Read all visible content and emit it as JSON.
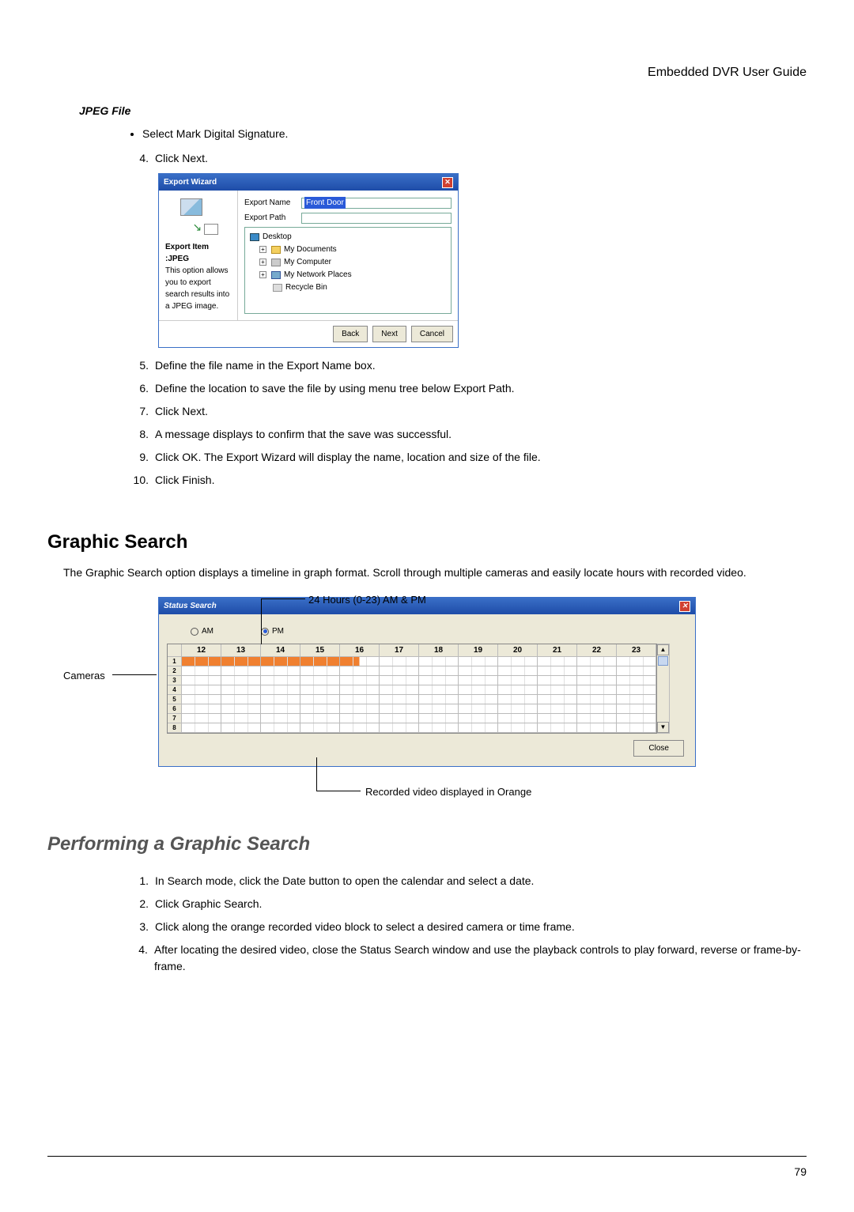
{
  "header": {
    "title": "Embedded DVR User Guide"
  },
  "page_number": "79",
  "jpeg_file": {
    "heading": "JPEG File",
    "bullet1": "Select Mark Digital Signature.",
    "step4_num": "4.",
    "step4": "Click Next.",
    "step5_num": "5.",
    "step5_a": "Define the file name in the ",
    "step5_b": "Export Name ",
    "step5_c": "box.",
    "step6_num": "6.",
    "step6_a": "Define the location to save the file by using menu tree below ",
    "step6_b": "Export Path.",
    "step7_num": "7.",
    "step7": "Click Next.",
    "step8_num": "8.",
    "step8": "A message displays to confirm that the save was successful.",
    "step9_num": "9.",
    "step9": "Click OK. The Export Wizard will display the name, location and size of the file.",
    "step10_num": "10.",
    "step10": "Click Finish."
  },
  "wizard": {
    "title": "Export Wizard",
    "side_title": "Export Item :JPEG",
    "side_desc": "This option allows you to export search results into a JPEG image.",
    "name_label": "Export Name",
    "name_value": "Front Door",
    "path_label": "Export Path",
    "tree": {
      "desktop": "Desktop",
      "docs": "My Documents",
      "comp": "My Computer",
      "net": "My Network Places",
      "bin": "Recycle Bin"
    },
    "back": "Back",
    "next": "Next",
    "cancel": "Cancel"
  },
  "graphic_search": {
    "heading": "Graphic Search",
    "intro": "The Graphic Search option displays a timeline in graph format. Scroll through multiple cameras and easily locate hours with recorded video.",
    "callout_hours": "24 Hours (0-23) AM & PM",
    "callout_cameras": "Cameras",
    "callout_recorded": "Recorded video displayed in Orange"
  },
  "status_search": {
    "title": "Status Search",
    "am": "AM",
    "pm": "PM",
    "hours": [
      "12",
      "13",
      "14",
      "15",
      "16",
      "17",
      "18",
      "19",
      "20",
      "21",
      "22",
      "23"
    ],
    "cameras": [
      "1",
      "2",
      "3",
      "4",
      "5",
      "6",
      "7",
      "8"
    ],
    "close": "Close"
  },
  "performing": {
    "heading": "Performing a Graphic Search",
    "step1_num": "1.",
    "step1": "In Search mode, click the Date button to open the calendar and select a date.",
    "step2_num": "2.",
    "step2": "Click Graphic Search.",
    "step3_num": "3.",
    "step3": "Click along the orange recorded video block to select a desired camera or time frame.",
    "step4_num": "4.",
    "step4": "After locating the desired video, close the Status Search window and use the playback controls to play forward, reverse or frame-by-frame."
  }
}
